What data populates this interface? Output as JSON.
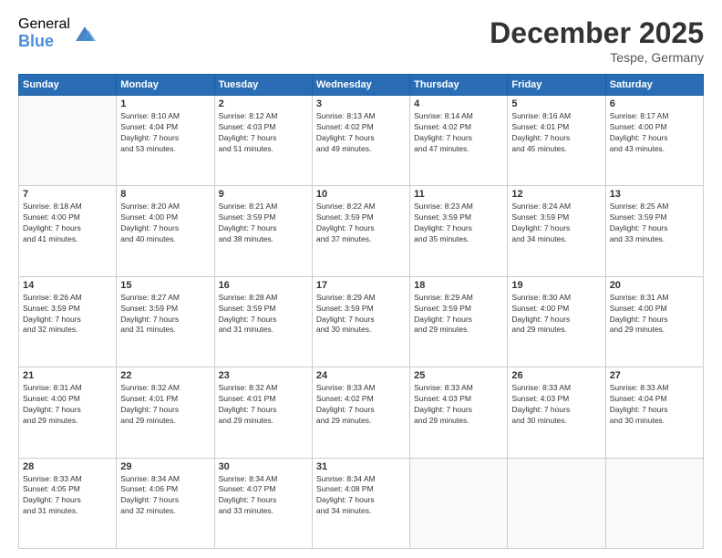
{
  "header": {
    "logo_general": "General",
    "logo_blue": "Blue",
    "title": "December 2025",
    "location": "Tespe, Germany"
  },
  "days_of_week": [
    "Sunday",
    "Monday",
    "Tuesday",
    "Wednesday",
    "Thursday",
    "Friday",
    "Saturday"
  ],
  "weeks": [
    [
      {
        "day": "",
        "info": []
      },
      {
        "day": "1",
        "info": [
          "Sunrise: 8:10 AM",
          "Sunset: 4:04 PM",
          "Daylight: 7 hours",
          "and 53 minutes."
        ]
      },
      {
        "day": "2",
        "info": [
          "Sunrise: 8:12 AM",
          "Sunset: 4:03 PM",
          "Daylight: 7 hours",
          "and 51 minutes."
        ]
      },
      {
        "day": "3",
        "info": [
          "Sunrise: 8:13 AM",
          "Sunset: 4:02 PM",
          "Daylight: 7 hours",
          "and 49 minutes."
        ]
      },
      {
        "day": "4",
        "info": [
          "Sunrise: 8:14 AM",
          "Sunset: 4:02 PM",
          "Daylight: 7 hours",
          "and 47 minutes."
        ]
      },
      {
        "day": "5",
        "info": [
          "Sunrise: 8:16 AM",
          "Sunset: 4:01 PM",
          "Daylight: 7 hours",
          "and 45 minutes."
        ]
      },
      {
        "day": "6",
        "info": [
          "Sunrise: 8:17 AM",
          "Sunset: 4:00 PM",
          "Daylight: 7 hours",
          "and 43 minutes."
        ]
      }
    ],
    [
      {
        "day": "7",
        "info": [
          "Sunrise: 8:18 AM",
          "Sunset: 4:00 PM",
          "Daylight: 7 hours",
          "and 41 minutes."
        ]
      },
      {
        "day": "8",
        "info": [
          "Sunrise: 8:20 AM",
          "Sunset: 4:00 PM",
          "Daylight: 7 hours",
          "and 40 minutes."
        ]
      },
      {
        "day": "9",
        "info": [
          "Sunrise: 8:21 AM",
          "Sunset: 3:59 PM",
          "Daylight: 7 hours",
          "and 38 minutes."
        ]
      },
      {
        "day": "10",
        "info": [
          "Sunrise: 8:22 AM",
          "Sunset: 3:59 PM",
          "Daylight: 7 hours",
          "and 37 minutes."
        ]
      },
      {
        "day": "11",
        "info": [
          "Sunrise: 8:23 AM",
          "Sunset: 3:59 PM",
          "Daylight: 7 hours",
          "and 35 minutes."
        ]
      },
      {
        "day": "12",
        "info": [
          "Sunrise: 8:24 AM",
          "Sunset: 3:59 PM",
          "Daylight: 7 hours",
          "and 34 minutes."
        ]
      },
      {
        "day": "13",
        "info": [
          "Sunrise: 8:25 AM",
          "Sunset: 3:59 PM",
          "Daylight: 7 hours",
          "and 33 minutes."
        ]
      }
    ],
    [
      {
        "day": "14",
        "info": [
          "Sunrise: 8:26 AM",
          "Sunset: 3:59 PM",
          "Daylight: 7 hours",
          "and 32 minutes."
        ]
      },
      {
        "day": "15",
        "info": [
          "Sunrise: 8:27 AM",
          "Sunset: 3:59 PM",
          "Daylight: 7 hours",
          "and 31 minutes."
        ]
      },
      {
        "day": "16",
        "info": [
          "Sunrise: 8:28 AM",
          "Sunset: 3:59 PM",
          "Daylight: 7 hours",
          "and 31 minutes."
        ]
      },
      {
        "day": "17",
        "info": [
          "Sunrise: 8:29 AM",
          "Sunset: 3:59 PM",
          "Daylight: 7 hours",
          "and 30 minutes."
        ]
      },
      {
        "day": "18",
        "info": [
          "Sunrise: 8:29 AM",
          "Sunset: 3:59 PM",
          "Daylight: 7 hours",
          "and 29 minutes."
        ]
      },
      {
        "day": "19",
        "info": [
          "Sunrise: 8:30 AM",
          "Sunset: 4:00 PM",
          "Daylight: 7 hours",
          "and 29 minutes."
        ]
      },
      {
        "day": "20",
        "info": [
          "Sunrise: 8:31 AM",
          "Sunset: 4:00 PM",
          "Daylight: 7 hours",
          "and 29 minutes."
        ]
      }
    ],
    [
      {
        "day": "21",
        "info": [
          "Sunrise: 8:31 AM",
          "Sunset: 4:00 PM",
          "Daylight: 7 hours",
          "and 29 minutes."
        ]
      },
      {
        "day": "22",
        "info": [
          "Sunrise: 8:32 AM",
          "Sunset: 4:01 PM",
          "Daylight: 7 hours",
          "and 29 minutes."
        ]
      },
      {
        "day": "23",
        "info": [
          "Sunrise: 8:32 AM",
          "Sunset: 4:01 PM",
          "Daylight: 7 hours",
          "and 29 minutes."
        ]
      },
      {
        "day": "24",
        "info": [
          "Sunrise: 8:33 AM",
          "Sunset: 4:02 PM",
          "Daylight: 7 hours",
          "and 29 minutes."
        ]
      },
      {
        "day": "25",
        "info": [
          "Sunrise: 8:33 AM",
          "Sunset: 4:03 PM",
          "Daylight: 7 hours",
          "and 29 minutes."
        ]
      },
      {
        "day": "26",
        "info": [
          "Sunrise: 8:33 AM",
          "Sunset: 4:03 PM",
          "Daylight: 7 hours",
          "and 30 minutes."
        ]
      },
      {
        "day": "27",
        "info": [
          "Sunrise: 8:33 AM",
          "Sunset: 4:04 PM",
          "Daylight: 7 hours",
          "and 30 minutes."
        ]
      }
    ],
    [
      {
        "day": "28",
        "info": [
          "Sunrise: 8:33 AM",
          "Sunset: 4:05 PM",
          "Daylight: 7 hours",
          "and 31 minutes."
        ]
      },
      {
        "day": "29",
        "info": [
          "Sunrise: 8:34 AM",
          "Sunset: 4:06 PM",
          "Daylight: 7 hours",
          "and 32 minutes."
        ]
      },
      {
        "day": "30",
        "info": [
          "Sunrise: 8:34 AM",
          "Sunset: 4:07 PM",
          "Daylight: 7 hours",
          "and 33 minutes."
        ]
      },
      {
        "day": "31",
        "info": [
          "Sunrise: 8:34 AM",
          "Sunset: 4:08 PM",
          "Daylight: 7 hours",
          "and 34 minutes."
        ]
      },
      {
        "day": "",
        "info": []
      },
      {
        "day": "",
        "info": []
      },
      {
        "day": "",
        "info": []
      }
    ]
  ]
}
